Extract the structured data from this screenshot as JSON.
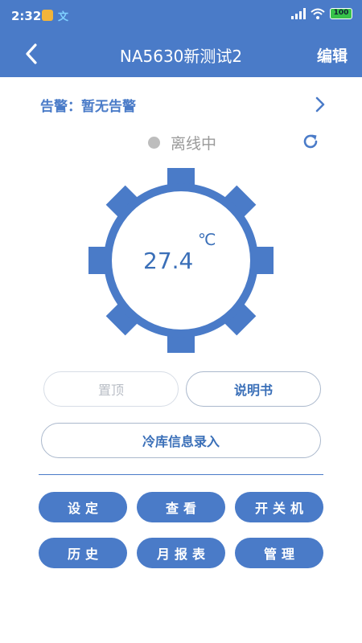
{
  "status_bar": {
    "time": "2:32",
    "battery": "100"
  },
  "header": {
    "title": "NA5630新测试2",
    "edit_label": "编辑"
  },
  "alarm": {
    "text": "告警：暂无告警"
  },
  "device": {
    "status": "离线中",
    "temperature": "27.4",
    "unit": "℃"
  },
  "buttons": {
    "pin_top": "置顶",
    "manual": "说明书",
    "cold_storage_entry": "冷库信息录入"
  },
  "actions": [
    {
      "label": "设定"
    },
    {
      "label": "查看"
    },
    {
      "label": "开关机"
    },
    {
      "label": "历史"
    },
    {
      "label": "月报表"
    },
    {
      "label": "管理"
    }
  ],
  "colors": {
    "accent": "#4a7bc8",
    "offline": "#bdbdbd"
  }
}
